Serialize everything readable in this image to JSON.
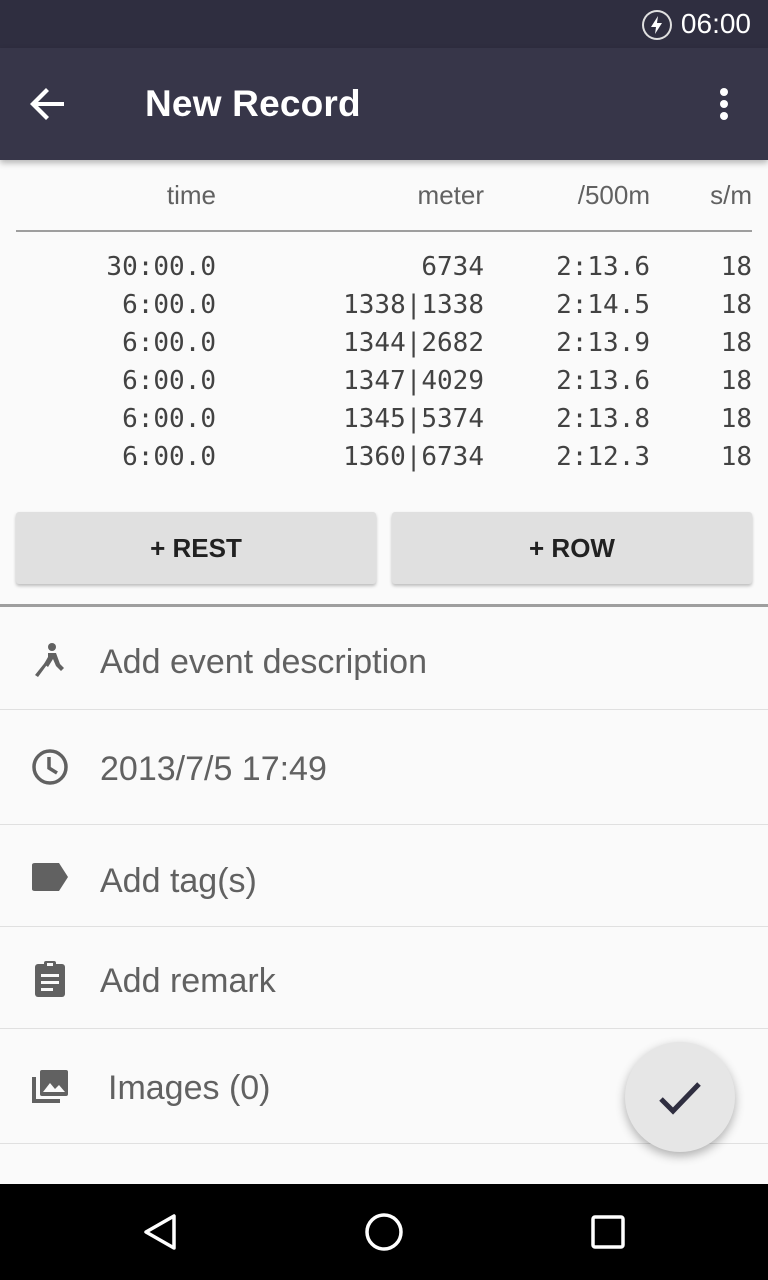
{
  "status_bar": {
    "time": "06:00",
    "icons": [
      "battery-charging-icon"
    ]
  },
  "app_bar": {
    "title": "New Record",
    "icons": [
      "arrow-back-icon",
      "more-vert-icon"
    ]
  },
  "table": {
    "columns": [
      "time",
      "meter",
      "/500m",
      "s/m"
    ],
    "rows": [
      [
        "30:00.0",
        "6734",
        "2:13.6",
        "18"
      ],
      [
        "6:00.0",
        "1338|1338",
        "2:14.5",
        "18"
      ],
      [
        "6:00.0",
        "1344|2682",
        "2:13.9",
        "18"
      ],
      [
        "6:00.0",
        "1347|4029",
        "2:13.6",
        "18"
      ],
      [
        "6:00.0",
        "1345|5374",
        "2:13.8",
        "18"
      ],
      [
        "6:00.0",
        "1360|6734",
        "2:12.3",
        "18"
      ]
    ]
  },
  "buttons": {
    "rest": "+ REST",
    "row": "+ ROW"
  },
  "fields": {
    "event": {
      "text": "Add event description",
      "icon": "rowing-icon"
    },
    "datetime": {
      "text": "2013/7/5 17:49",
      "icon": "clock-icon"
    },
    "tags": {
      "text": "Add tag(s)",
      "icon": "label-icon"
    },
    "remark": {
      "text": "Add remark",
      "icon": "clipboard-icon"
    },
    "images": {
      "text": "Images (0)",
      "icon": "image-icon"
    }
  },
  "fab": {
    "icon": "check-icon"
  },
  "nav_bar": {
    "icons": [
      "back-triangle-icon",
      "home-circle-icon",
      "recents-square-icon"
    ]
  },
  "colors": {
    "status_bar": "#2f2e40",
    "app_bar": "#373649",
    "accent": "#373649",
    "background": "#fafafa"
  }
}
